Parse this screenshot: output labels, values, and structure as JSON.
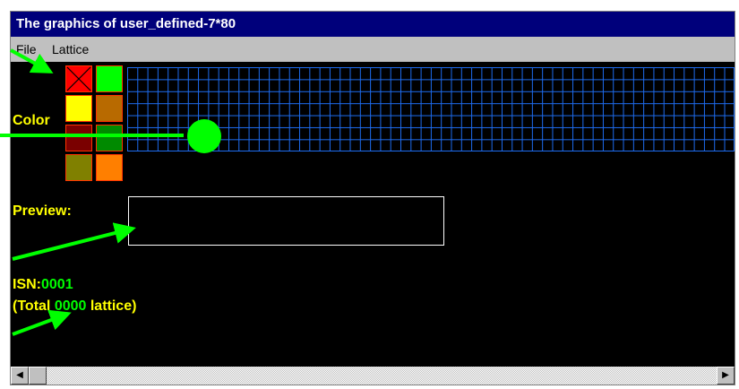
{
  "window": {
    "title": "The graphics of user_defined-7*80"
  },
  "menu": {
    "items": [
      {
        "label": "File"
      },
      {
        "label": "Lattice"
      }
    ]
  },
  "palette": {
    "label": "Color",
    "swatches": [
      {
        "color": "#ff0000",
        "crossed": true
      },
      {
        "color": "#00ff00",
        "crossed": false
      },
      {
        "color": "#ffff00",
        "crossed": false
      },
      {
        "color": "#b86a00",
        "crossed": false
      },
      {
        "color": "#7a0000",
        "crossed": false
      },
      {
        "color": "#008a00",
        "crossed": false
      },
      {
        "color": "#808000",
        "crossed": false
      },
      {
        "color": "#ff7f00",
        "crossed": false
      }
    ]
  },
  "lattice_grid": {
    "rows": 7,
    "columns": 80,
    "line_color": "#1e6cf0"
  },
  "preview": {
    "label": "Preview:"
  },
  "status": {
    "isn_label": "ISN:",
    "isn_value": "0001",
    "total_prefix": "(Total ",
    "total_value": "0000",
    "total_suffix": " lattice)"
  },
  "scrollbar": {
    "left_arrow": "◀",
    "right_arrow": "▶"
  },
  "annotation_color": "#00ff00"
}
